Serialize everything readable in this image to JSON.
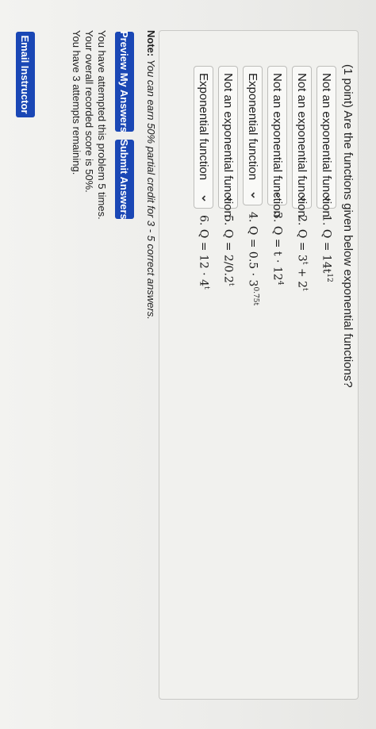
{
  "problem": {
    "title": "(1 point) Are the functions given below exponential functions?",
    "rows": [
      {
        "selected": "Not an exponential function",
        "number": "1.",
        "equation": "Q = 14t",
        "sup": "12"
      },
      {
        "selected": "Not an exponential function",
        "number": "2.",
        "equation": "Q = 3",
        "sup": "t",
        "tail": " + 2",
        "sup2": "t"
      },
      {
        "selected": "Not an exponential function",
        "number": "3.",
        "equation": "Q = t · 12",
        "sup": "4"
      },
      {
        "selected": "Exponential function",
        "number": "4.",
        "equation": "Q = 0.5 · 3",
        "sup": "0.75t"
      },
      {
        "selected": "Not an exponential function",
        "number": "5.",
        "equation": "Q = 2/0.2",
        "sup": "t"
      },
      {
        "selected": "Exponential function",
        "number": "6.",
        "equation": "Q = 12 · 4",
        "sup": "t"
      }
    ]
  },
  "note": {
    "label": "Note:",
    "text": "You can earn 50% partial credit for 3 - 5 correct answers."
  },
  "buttons": {
    "preview": "Preview My Answers",
    "submit": "Submit Answers",
    "email": "Email Instructor"
  },
  "status": {
    "attempted": "You have attempted this problem 5 times.",
    "score": "Your overall recorded score is 50%.",
    "remaining": "You have 3 attempts remaining."
  },
  "colors": {
    "button": "#1a47b5",
    "button_text": "#ffffff"
  }
}
